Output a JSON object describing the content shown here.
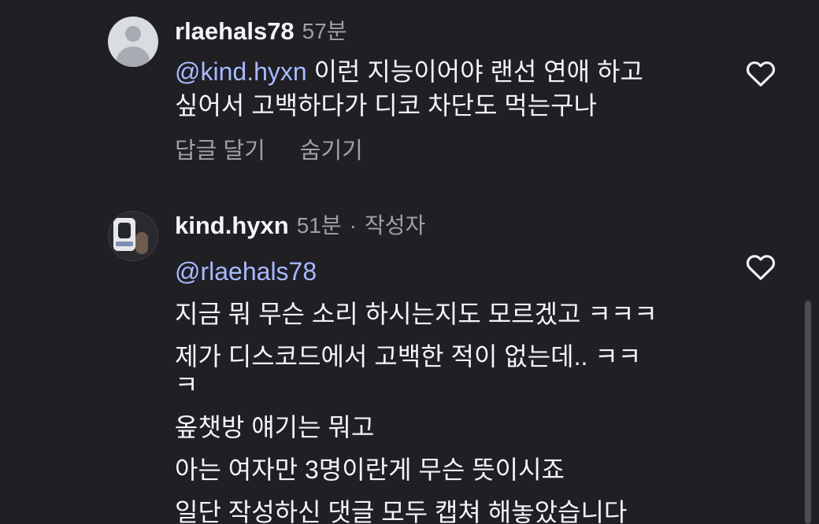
{
  "comments": [
    {
      "username": "rlaehals78",
      "time": "57분",
      "mention": "@kind.hyxn",
      "text_line_1": " 이런 지능이어야 랜선 연애 하고",
      "text_line_2": "싶어서 고백하다가 디코 차단도 먹는구나",
      "reply_label": "답글 달기",
      "hide_label": "숨기기",
      "like_icon": "heart-outline"
    },
    {
      "username": "kind.hyxn",
      "time": "51분",
      "separator": "·",
      "author_badge": "작성자",
      "mention": "@rlaehals78",
      "lines": [
        "지금 뭐 무슨 소리 하시는지도 모르겠고 ㅋㅋㅋ",
        "제가 디스코드에서 고백한 적이 없는데.. ㅋㅋ",
        "ㅋ",
        "옾챗방 얘기는 뭐고",
        "아는 여자만 3명이란게 무슨 뜻이시죠",
        "일단 작성하신 댓글 모두 캡쳐 해놓았습니다"
      ],
      "like_icon": "heart-outline"
    }
  ],
  "colors": {
    "background": "#1f1f24",
    "mention": "#a9b9ff",
    "secondary_text": "#9da0a8"
  }
}
